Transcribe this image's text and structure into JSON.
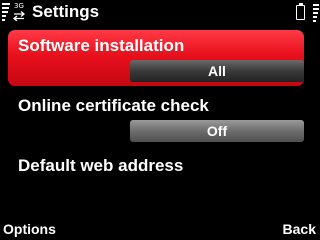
{
  "status": {
    "network_badge": "3G",
    "title": "Settings"
  },
  "settings": [
    {
      "label": "Software installation",
      "value": "All",
      "selected": true
    },
    {
      "label": "Online certificate check",
      "value": "Off",
      "selected": false
    },
    {
      "label": "Default web address",
      "value": "",
      "selected": false
    }
  ],
  "softkeys": {
    "left": "Options",
    "right": "Back"
  },
  "colors": {
    "highlight": "#e8101c",
    "background": "#000000",
    "value_box": "#6d6d6d"
  }
}
